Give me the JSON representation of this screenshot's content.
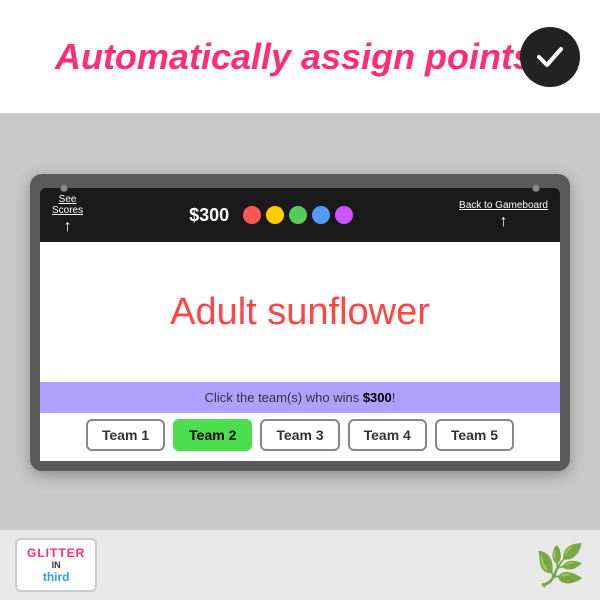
{
  "top_banner": {
    "text": "Automatically assign points!",
    "checkmark": "✓"
  },
  "whiteboard": {
    "see_scores_label": "See",
    "see_scores_label2": "Scores",
    "price": "$300",
    "dots": [
      {
        "color": "#ff5555"
      },
      {
        "color": "#ffcc00"
      },
      {
        "color": "#55cc55"
      },
      {
        "color": "#5599ff"
      },
      {
        "color": "#cc55ff"
      }
    ],
    "back_to_gameboard": "Back to Gameboard",
    "question": "Adult sunflower",
    "bottom_bar_text": "Click the team(s) who wins ",
    "bottom_bar_price": "$300",
    "bottom_bar_exclaim": "!"
  },
  "teams": [
    {
      "label": "Team 1",
      "selected": false
    },
    {
      "label": "Team 2",
      "selected": true
    },
    {
      "label": "Team 3",
      "selected": false
    },
    {
      "label": "Team 4",
      "selected": false
    },
    {
      "label": "Team 5",
      "selected": false
    }
  ],
  "logo": {
    "glitter": "GLITTER",
    "in": "IN",
    "third": "third"
  }
}
